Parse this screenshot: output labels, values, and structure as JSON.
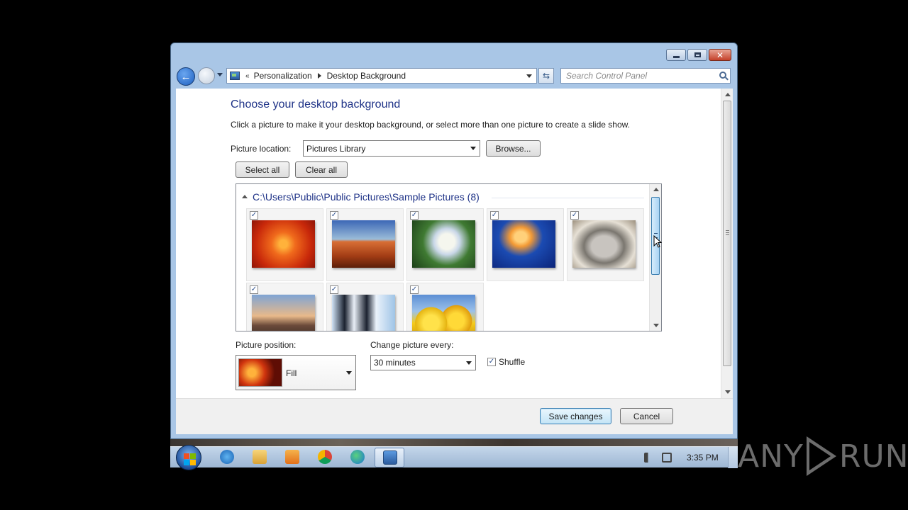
{
  "window": {
    "title_controls": {
      "minimize": "minimize",
      "maximize": "maximize",
      "close": "close"
    }
  },
  "nav": {
    "breadcrumb_sep": "«",
    "crumbs": [
      "Personalization",
      "Desktop Background"
    ],
    "search_placeholder": "Search Control Panel"
  },
  "main": {
    "title": "Choose your desktop background",
    "description": "Click a picture to make it your desktop background, or select more than one picture to create a slide show.",
    "picture_location_label": "Picture location:",
    "picture_location_value": "Pictures Library",
    "browse_label": "Browse...",
    "select_all_label": "Select all",
    "clear_all_label": "Clear all",
    "group_header": "C:\\Users\\Public\\Public Pictures\\Sample Pictures (8)",
    "pictures": [
      {
        "name": "chrysanthemum",
        "checked": "✓"
      },
      {
        "name": "desert",
        "checked": "✓"
      },
      {
        "name": "hydrangeas",
        "checked": "✓"
      },
      {
        "name": "jellyfish",
        "checked": "✓"
      },
      {
        "name": "koala",
        "checked": "✓"
      },
      {
        "name": "lighthouse",
        "checked": "✓"
      },
      {
        "name": "penguins",
        "checked": "✓"
      },
      {
        "name": "tulips",
        "checked": "✓"
      }
    ],
    "picture_position_label": "Picture position:",
    "picture_position_value": "Fill",
    "change_every_label": "Change picture every:",
    "change_every_value": "30 minutes",
    "shuffle_label": "Shuffle",
    "shuffle_checked": "✓"
  },
  "footer": {
    "save_label": "Save changes",
    "cancel_label": "Cancel"
  },
  "taskbar": {
    "clock": "3:35 PM",
    "icons": [
      "internet-explorer-icon",
      "file-explorer-icon",
      "media-player-icon",
      "chrome-icon",
      "edge-icon",
      "control-panel-icon"
    ]
  },
  "watermark": {
    "left": "ANY",
    "right": "RUN"
  }
}
